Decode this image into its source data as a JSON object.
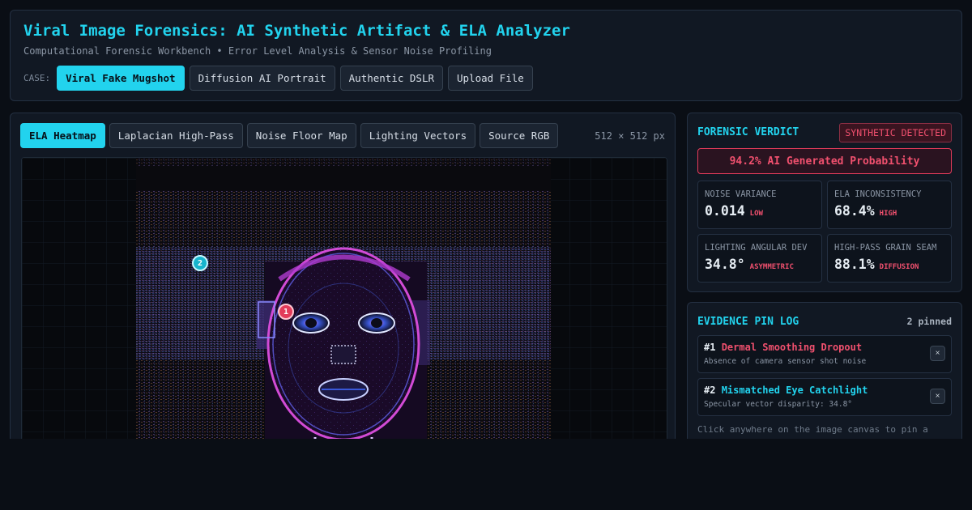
{
  "header": {
    "title": "Viral Image Forensics: AI Synthetic Artifact & ELA Analyzer",
    "subtitle": "Computational Forensic Workbench • Error Level Analysis & Sensor Noise Profiling",
    "case_label": "CASE:",
    "cases": [
      "Viral Fake Mugshot",
      "Diffusion AI Portrait",
      "Authentic DSLR",
      "Upload File"
    ],
    "active_case": "Viral Fake Mugshot"
  },
  "viewer": {
    "tabs": [
      "ELA Heatmap",
      "Laplacian High-Pass",
      "Noise Floor Map",
      "Lighting Vectors",
      "Source RGB"
    ],
    "active_tab": "ELA Heatmap",
    "dimensions": "512 × 512 px",
    "pins": [
      "1",
      "2"
    ]
  },
  "verdict": {
    "title": "FORENSIC VERDICT",
    "badge": "SYNTHETIC DETECTED",
    "probability": "94.2% AI Generated Probability",
    "metrics": [
      {
        "label": "NOISE VARIANCE",
        "value": "0.014",
        "tag": "LOW"
      },
      {
        "label": "ELA INCONSISTENCY",
        "value": "68.4%",
        "tag": "HIGH"
      },
      {
        "label": "LIGHTING ANGULAR DEV",
        "value": "34.8°",
        "tag": "ASYMMETRIC"
      },
      {
        "label": "HIGH-PASS GRAIN SEAM",
        "value": "88.1%",
        "tag": "DIFFUSION"
      }
    ]
  },
  "pinlog": {
    "title": "EVIDENCE PIN LOG",
    "count": "2 pinned",
    "items": [
      {
        "num": "#1",
        "title": "Dermal Smoothing Dropout",
        "desc": "Absence of camera sensor shot noise",
        "color": "#f0506e"
      },
      {
        "num": "#2",
        "title": "Mismatched Eye Catchlight",
        "desc": "Specular vector disparity: 34.8°",
        "color": "#22d3ee"
      }
    ],
    "remove_label": "×",
    "hint": "Click anywhere on the image canvas to pin a forensic anomaly annotation to the log."
  },
  "colors": {
    "accent": "#22d3ee",
    "alert": "#f0506e",
    "panel": "#111823",
    "background": "#0a0e15"
  }
}
